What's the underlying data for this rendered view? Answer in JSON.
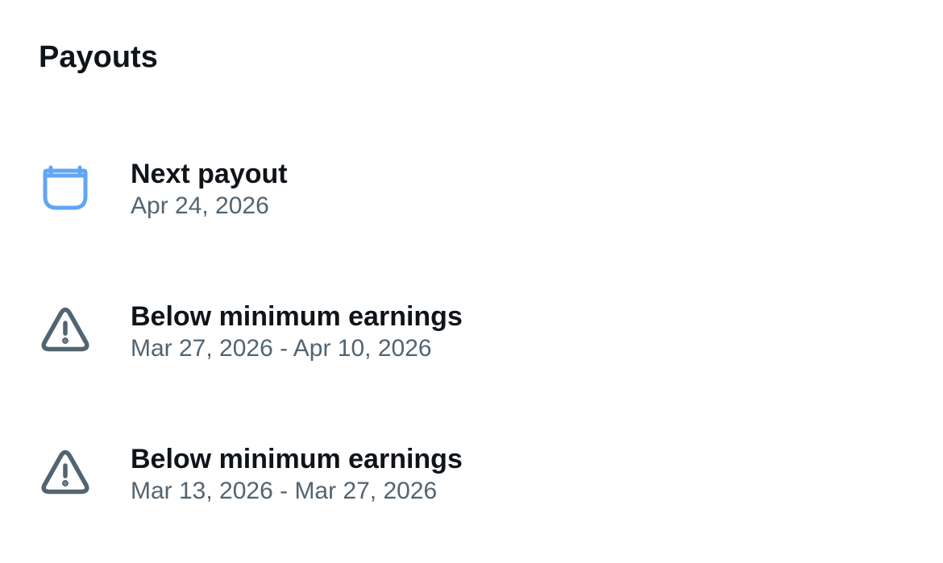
{
  "header": {
    "title": "Payouts"
  },
  "payouts": [
    {
      "icon": "calendar-icon",
      "title": "Next payout",
      "subtitle": "Apr 24, 2026"
    },
    {
      "icon": "warning-icon",
      "title": "Below minimum earnings",
      "subtitle": "Mar 27, 2026 - Apr 10, 2026"
    },
    {
      "icon": "warning-icon",
      "title": "Below minimum earnings",
      "subtitle": "Mar 13, 2026 - Mar 27, 2026"
    }
  ],
  "colors": {
    "calendar_icon": "#62a5f5",
    "warning_icon": "#536471",
    "title_text": "#0f1419",
    "subtitle_text": "#536471"
  }
}
